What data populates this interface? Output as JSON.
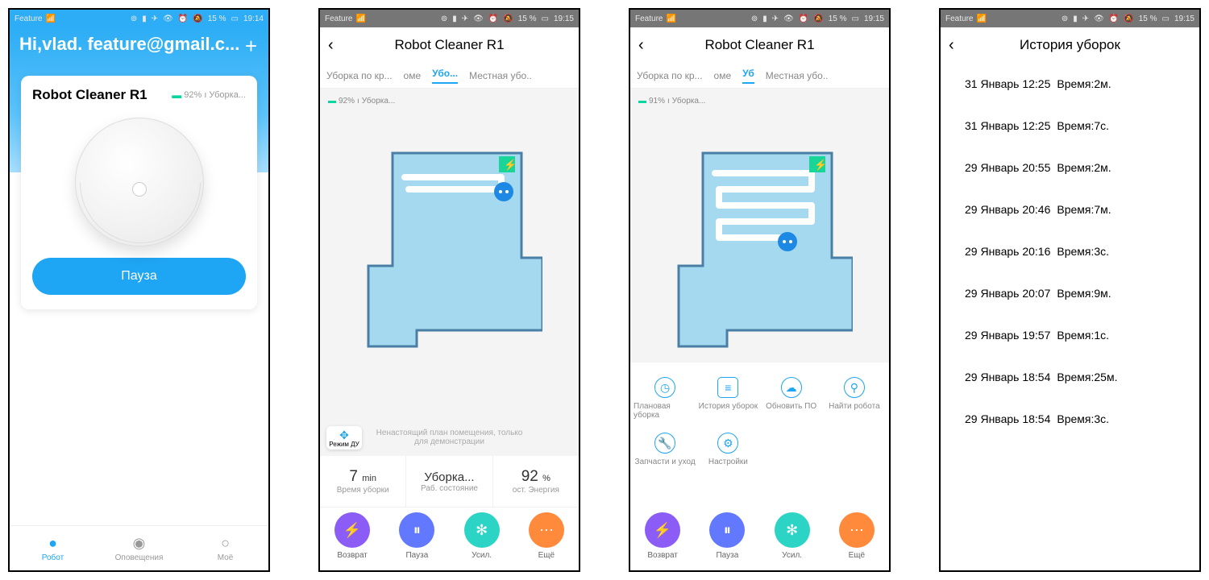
{
  "status_bar": {
    "feature": "Feature",
    "battery": "15 %",
    "time1": "19:14",
    "time2": "19:15"
  },
  "screen1": {
    "greeting": "Hi,vlad. feature@gmail.c...",
    "card_title": "Robot Cleaner R1",
    "battery_pct": "92%",
    "state": "Уборка...",
    "pause": "Пауза",
    "nav": {
      "robot": "Робот",
      "alerts": "Оповещения",
      "me": "Моё"
    }
  },
  "screen2": {
    "title": "Robot Cleaner R1",
    "tabs": {
      "edge": "Уборка по кр...",
      "home_frag": "оме",
      "clean": "Убо...",
      "local": "Местная убо.."
    },
    "battery": "92%",
    "state": "Уборка...",
    "demo_note": "Ненастоящий план помещения, только для демонстрации",
    "rc": "Режим ДУ",
    "stats": {
      "time_val": "7",
      "time_unit": "min",
      "time_label": "Время уборки",
      "state_val": "Уборка...",
      "state_label": "Раб. состояние",
      "energy_val": "92",
      "energy_unit": "%",
      "energy_label": "ост. Энергия"
    },
    "actions": {
      "return": "Возврат",
      "pause": "Пауза",
      "boost": "Усил.",
      "more": "Ещё"
    }
  },
  "screen3": {
    "title": "Robot Cleaner R1",
    "tabs": {
      "edge": "Уборка по кр...",
      "home_frag": "оме",
      "clean": "Уб",
      "local": "Местная убо.."
    },
    "battery": "91%",
    "state": "Уборка...",
    "menu": {
      "schedule": "Плановая уборка",
      "history": "История уборок",
      "update": "Обновить ПО",
      "find": "Найти робота",
      "parts": "Запчасти и уход",
      "settings": "Настройки"
    },
    "actions": {
      "return": "Возврат",
      "pause": "Пауза",
      "boost": "Усил.",
      "more": "Ещё"
    }
  },
  "screen4": {
    "title": "История уборок",
    "items": [
      {
        "date": "31 Январь 12:25",
        "dur": "Время:2м."
      },
      {
        "date": "31 Январь 12:25",
        "dur": "Время:7с."
      },
      {
        "date": "29 Январь 20:55",
        "dur": "Время:2м."
      },
      {
        "date": "29 Январь 20:46",
        "dur": "Время:7м."
      },
      {
        "date": "29 Январь 20:16",
        "dur": "Время:3с."
      },
      {
        "date": "29 Январь 20:07",
        "dur": "Время:9м."
      },
      {
        "date": "29 Январь 19:57",
        "dur": "Время:1с."
      },
      {
        "date": "29 Январь 18:54",
        "dur": "Время:25м."
      },
      {
        "date": "29 Январь 18:54",
        "dur": "Время:3с."
      }
    ]
  }
}
